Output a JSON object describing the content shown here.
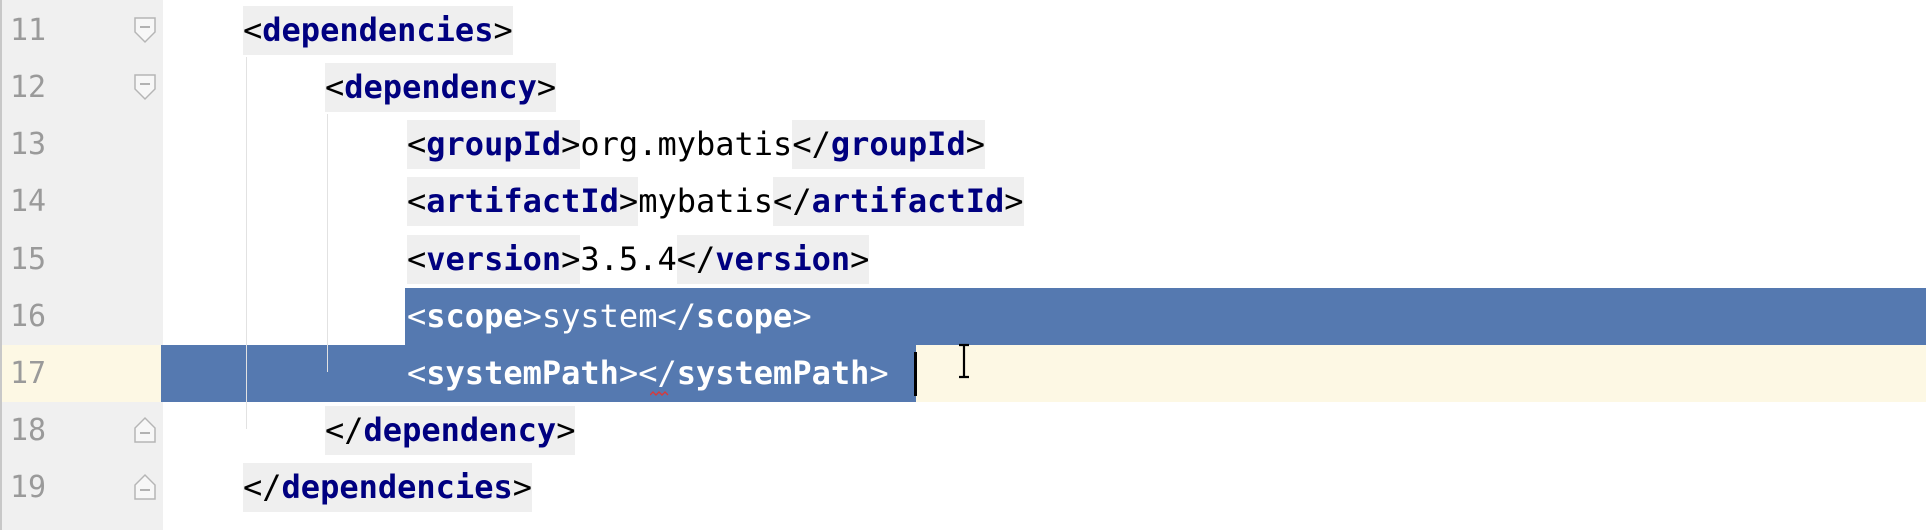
{
  "editor": {
    "language": "xml",
    "selection_color": "#5579b0",
    "current_line_color": "#fdf8e4",
    "tag_color": "#000080",
    "lines": [
      {
        "number": "11",
        "open": "<",
        "tag": "dependencies",
        "close": ">",
        "text": "",
        "end_open": "",
        "end_tag": "",
        "end_close": "",
        "fold": "open"
      },
      {
        "number": "12",
        "open": "<",
        "tag": "dependency",
        "close": ">",
        "text": "",
        "end_open": "",
        "end_tag": "",
        "end_close": "",
        "fold": "open"
      },
      {
        "number": "13",
        "open": "<",
        "tag": "groupId",
        "close": ">",
        "text": "org.mybatis",
        "end_open": "</",
        "end_tag": "groupId",
        "end_close": ">",
        "fold": "none"
      },
      {
        "number": "14",
        "open": "<",
        "tag": "artifactId",
        "close": ">",
        "text": "mybatis",
        "end_open": "</",
        "end_tag": "artifactId",
        "end_close": ">",
        "fold": "none"
      },
      {
        "number": "15",
        "open": "<",
        "tag": "version",
        "close": ">",
        "text": "3.5.4",
        "end_open": "</",
        "end_tag": "version",
        "end_close": ">",
        "fold": "none"
      },
      {
        "number": "16",
        "open": "<",
        "tag": "scope",
        "close": ">",
        "text": "system",
        "end_open": "</",
        "end_tag": "scope",
        "end_close": ">",
        "fold": "none"
      },
      {
        "number": "17",
        "open": "<",
        "tag": "systemPath",
        "close": ">",
        "text": "",
        "end_open": "</",
        "end_tag": "systemPath",
        "end_close": ">",
        "fold": "none"
      },
      {
        "number": "18",
        "open": "</",
        "tag": "dependency",
        "close": ">",
        "text": "",
        "end_open": "",
        "end_tag": "",
        "end_close": "",
        "fold": "close"
      },
      {
        "number": "19",
        "open": "</",
        "tag": "dependencies",
        "close": ">",
        "text": "",
        "end_open": "",
        "end_tag": "",
        "end_close": "",
        "fold": "close"
      }
    ]
  }
}
